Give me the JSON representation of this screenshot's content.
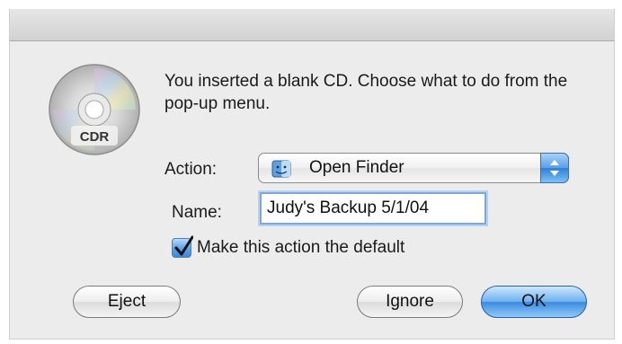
{
  "dialog": {
    "message": "You inserted a blank CD. Choose what to do from the pop-up menu.",
    "icon_label": "CDR",
    "icon": "cd-r-disc-icon"
  },
  "form": {
    "action_label": "Action:",
    "action_value": "Open Finder",
    "action_icon": "finder-icon",
    "name_label": "Name:",
    "name_value": "Judy's Backup 5/1/04",
    "default_checkbox_label": "Make this action the default",
    "default_checked": true
  },
  "buttons": {
    "eject": "Eject",
    "ignore": "Ignore",
    "ok": "OK"
  },
  "colors": {
    "dialog_bg": "#ececec",
    "accent_blue": "#3a8ae0"
  }
}
